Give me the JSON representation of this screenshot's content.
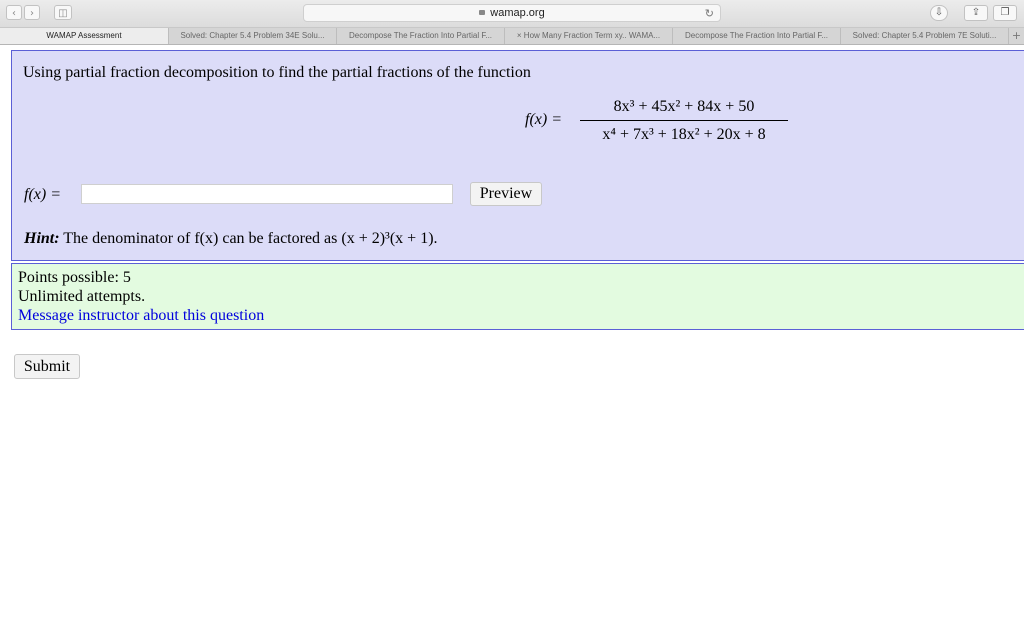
{
  "browser": {
    "address": "wamap.org",
    "tabs": [
      {
        "label": "WAMAP Assessment",
        "active": true
      },
      {
        "label": "Solved: Chapter 5.4 Problem 34E Solu...",
        "active": false
      },
      {
        "label": "Decompose The Fraction Into Partial F...",
        "active": false
      },
      {
        "label": "× How Many Fraction Term xy.. WAMA...",
        "active": false
      },
      {
        "label": "Decompose The Fraction Into Partial F...",
        "active": false
      },
      {
        "label": "Solved: Chapter 5.4 Problem 7E Soluti...",
        "active": false
      }
    ],
    "new_tab": "+"
  },
  "question": {
    "prompt": "Using partial fraction decomposition to find the partial fractions of the function",
    "function_label": "f(x) =",
    "numerator": "8x³ + 45x² + 84x + 50",
    "denominator": "x⁴ + 7x³ + 18x² + 20x + 8",
    "answer_label": "f(x) =",
    "answer_value": "",
    "preview_label": "Preview",
    "hint_prefix": "Hint:",
    "hint_text": "The denominator of f(x) can be factored as (x + 2)³(x + 1)."
  },
  "info": {
    "points": "Points possible: 5",
    "attempts": "Unlimited attempts.",
    "message_link": "Message instructor about this question"
  },
  "submit_label": "Submit"
}
